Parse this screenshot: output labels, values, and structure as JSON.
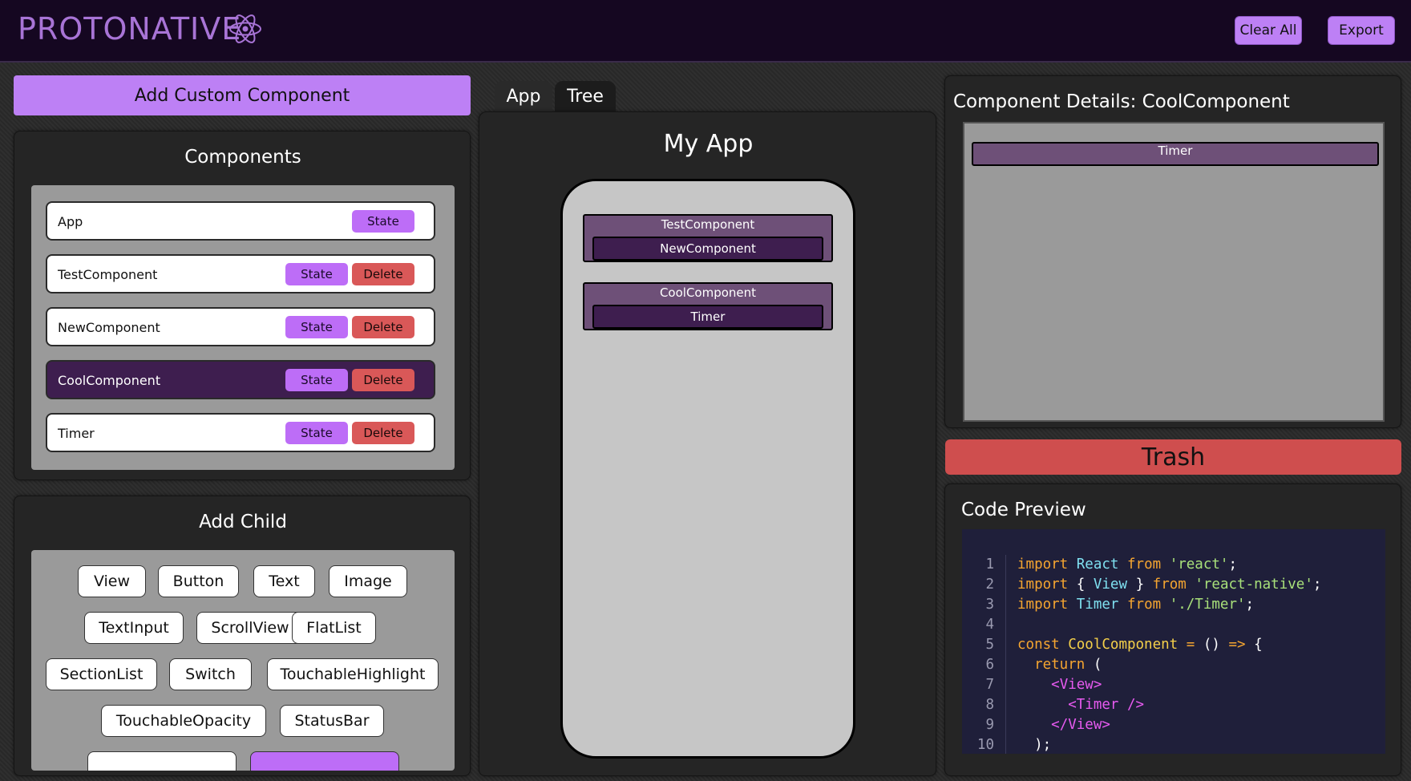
{
  "header": {
    "logo_text": "PROTONATIVE",
    "logo_icon": "atom-icon",
    "clear_all": "Clear All",
    "export": "Export"
  },
  "left": {
    "add_custom_component": "Add Custom Component",
    "components_title": "Components",
    "components": [
      {
        "name": "App",
        "state": "State",
        "delete": null,
        "selected": false
      },
      {
        "name": "TestComponent",
        "state": "State",
        "delete": "Delete",
        "selected": false
      },
      {
        "name": "NewComponent",
        "state": "State",
        "delete": "Delete",
        "selected": false
      },
      {
        "name": "CoolComponent",
        "state": "State",
        "delete": "Delete",
        "selected": true
      },
      {
        "name": "Timer",
        "state": "State",
        "delete": "Delete",
        "selected": false
      }
    ],
    "add_child_title": "Add Child",
    "children": [
      "View",
      "Button",
      "Text",
      "Image",
      "TextInput",
      "ScrollView",
      "FlatList",
      "SectionList",
      "Switch",
      "TouchableHighlight",
      "TouchableOpacity",
      "StatusBar"
    ]
  },
  "center": {
    "tabs": [
      "App",
      "Tree"
    ],
    "active_tab": "App",
    "title": "My App",
    "tree": [
      {
        "name": "TestComponent",
        "child": "NewComponent"
      },
      {
        "name": "CoolComponent",
        "child": "Timer"
      }
    ]
  },
  "right": {
    "details_title": "Component Details: CoolComponent",
    "details_child": "Timer",
    "trash": "Trash",
    "code_title": "Code Preview",
    "code_lines": [
      "import React from 'react';",
      "import { View } from 'react-native';",
      "import Timer from './Timer';",
      "",
      "const CoolComponent = () => {",
      "  return (",
      "    <View>",
      "      <Timer />",
      "    </View>",
      "  );"
    ]
  },
  "colors": {
    "accent": "#bd80f5",
    "delete": "#d95858",
    "selected": "#3e1e4f",
    "header_bg": "#150721",
    "code_bg": "#1f1f3a"
  }
}
